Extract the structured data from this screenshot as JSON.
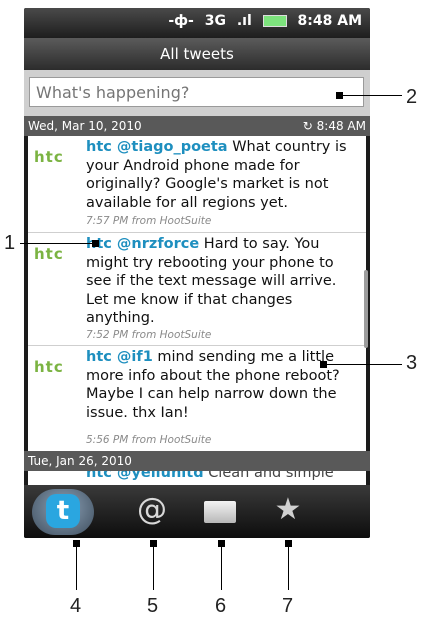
{
  "status_bar": {
    "network": "3G",
    "time": "8:48 AM"
  },
  "title": "All tweets",
  "compose": {
    "placeholder": "What's happening?"
  },
  "sections": [
    {
      "date": "Wed, Mar 10, 2010",
      "time": "8:48 AM"
    },
    {
      "date": "Tue, Jan 26, 2010"
    }
  ],
  "tweets": [
    {
      "prefix": "htc",
      "user": "@tiago_poeta",
      "text": "What country is your Android phone made for originally? Google's market is not available for all regions yet.",
      "meta": "7:57 PM from HootSuite"
    },
    {
      "prefix": "htc",
      "user": "@nrzforce",
      "text": "Hard to say. You might try rebooting your phone to see if the text message will arrive. Let me know if that changes anything.",
      "meta": "7:52 PM from HootSuite"
    },
    {
      "prefix": "htc",
      "user": "@if1",
      "text": "mind sending me a little more info about the phone reboot? Maybe I can help narrow down the issue. thx Ian!",
      "meta": "5:56 PM from HootSuite"
    }
  ],
  "peek_tweet": {
    "prefix": "htc",
    "user": "@yellunltd",
    "text": "Clean and simple"
  },
  "logo_text": "htc",
  "tabs": [
    {
      "name": "tab-twitter",
      "icon": "twitter-icon",
      "glyph": "t"
    },
    {
      "name": "tab-mentions",
      "icon": "at-icon",
      "glyph": "@"
    },
    {
      "name": "tab-messages",
      "icon": "mail-icon"
    },
    {
      "name": "tab-favorites",
      "icon": "star-icon",
      "glyph": "★"
    }
  ],
  "callouts": [
    "1",
    "2",
    "3",
    "4",
    "5",
    "6",
    "7"
  ]
}
